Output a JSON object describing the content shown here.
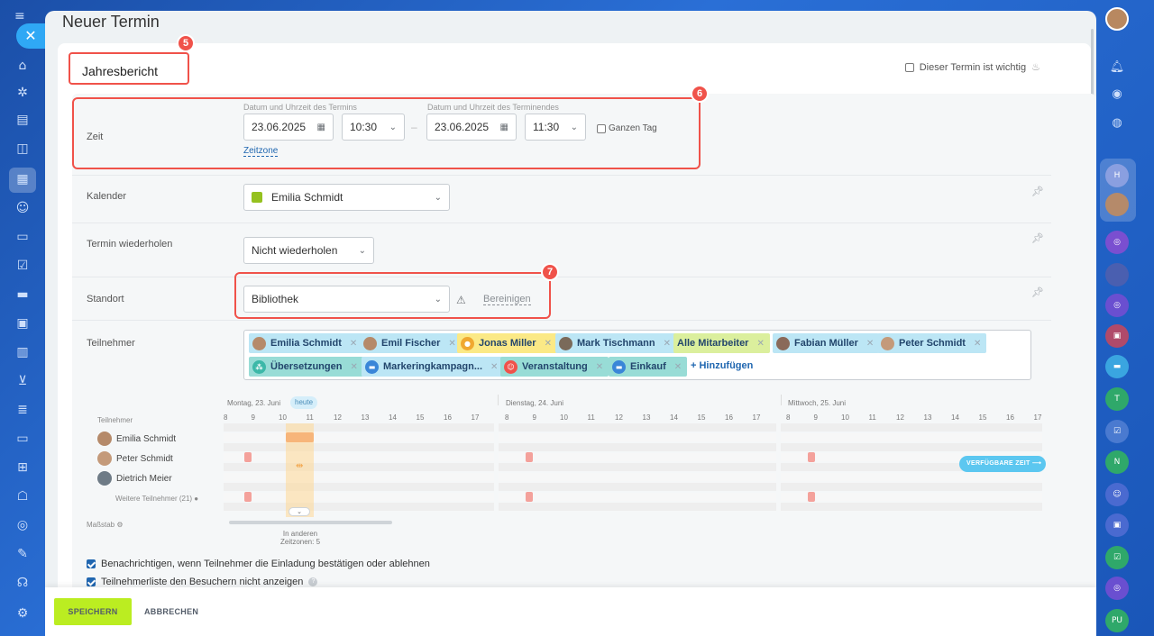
{
  "window": {
    "title": "Neuer Termin"
  },
  "event": {
    "name": "Jahresbericht",
    "important_label": "Dieser Termin ist wichtig"
  },
  "annotations": {
    "badge_name": "5",
    "badge_time": "6",
    "badge_location": "7"
  },
  "time": {
    "label": "Zeit",
    "start_sublabel": "Datum und Uhrzeit des Termins",
    "end_sublabel": "Datum und Uhrzeit des Terminendes",
    "start_date": "23.06.2025",
    "start_time": "10:30",
    "end_date": "23.06.2025",
    "end_time": "11:30",
    "all_day_label": "Ganzen Tag",
    "timezone_link": "Zeitzone"
  },
  "calendar": {
    "label": "Kalender",
    "value": "Emilia Schmidt",
    "color": "#95c11f"
  },
  "repeat": {
    "label": "Termin wiederholen",
    "value": "Nicht wiederholen"
  },
  "location": {
    "label": "Standort",
    "value": "Bibliothek",
    "clear_link": "Bereinigen"
  },
  "participants": {
    "label": "Teilnehmer",
    "tags": [
      {
        "label": "Emilia Schmidt",
        "color": "blue"
      },
      {
        "label": "Emil Fischer",
        "color": "blue"
      },
      {
        "label": "Jonas Miller",
        "color": "yellow"
      },
      {
        "label": "Mark Tischmann",
        "color": "blue"
      },
      {
        "label": "Alle Mitarbeiter",
        "color": "green"
      },
      {
        "label": "Fabian Müller",
        "color": "blue"
      },
      {
        "label": "Peter Schmidt",
        "color": "blue"
      },
      {
        "label": "Übersetzungen",
        "color": "teal"
      },
      {
        "label": "Markeringkampagn...",
        "color": "blue"
      },
      {
        "label": "Veranstaltung",
        "color": "teal"
      },
      {
        "label": "Einkauf",
        "color": "teal"
      }
    ],
    "add_link": "+ Hinzufügen"
  },
  "planner": {
    "days": [
      "Montag, 23. Juni",
      "Dienstag, 24. Juni",
      "Mittwoch, 25. Juni"
    ],
    "today_label": "heute",
    "participants_header": "Teilnehmer",
    "hours": [
      "8",
      "9",
      "10",
      "11",
      "12",
      "13",
      "14",
      "15",
      "16",
      "17"
    ],
    "people": [
      "Emilia Schmidt",
      "Peter Schmidt",
      "Dietrich Meier"
    ],
    "more_participants": "Weitere Teilnehmer (21)",
    "scale_label": "Maßstab",
    "other_timezones": "In anderen Zeitzonen: 5",
    "available_time_button": "VERFÜGBARE ZEIT"
  },
  "options": {
    "notify_label": "Benachrichtigen, wenn Teilnehmer die Einladung bestätigen oder ablehnen",
    "hide_list_label": "Teilnehmerliste den Besuchern nicht anzeigen"
  },
  "footer": {
    "save": "SPEICHERN",
    "cancel": "ABBRECHEN"
  },
  "colors": {
    "accent_red": "#f0524a",
    "save_green": "#bbed21",
    "link_blue": "#2067b0"
  }
}
